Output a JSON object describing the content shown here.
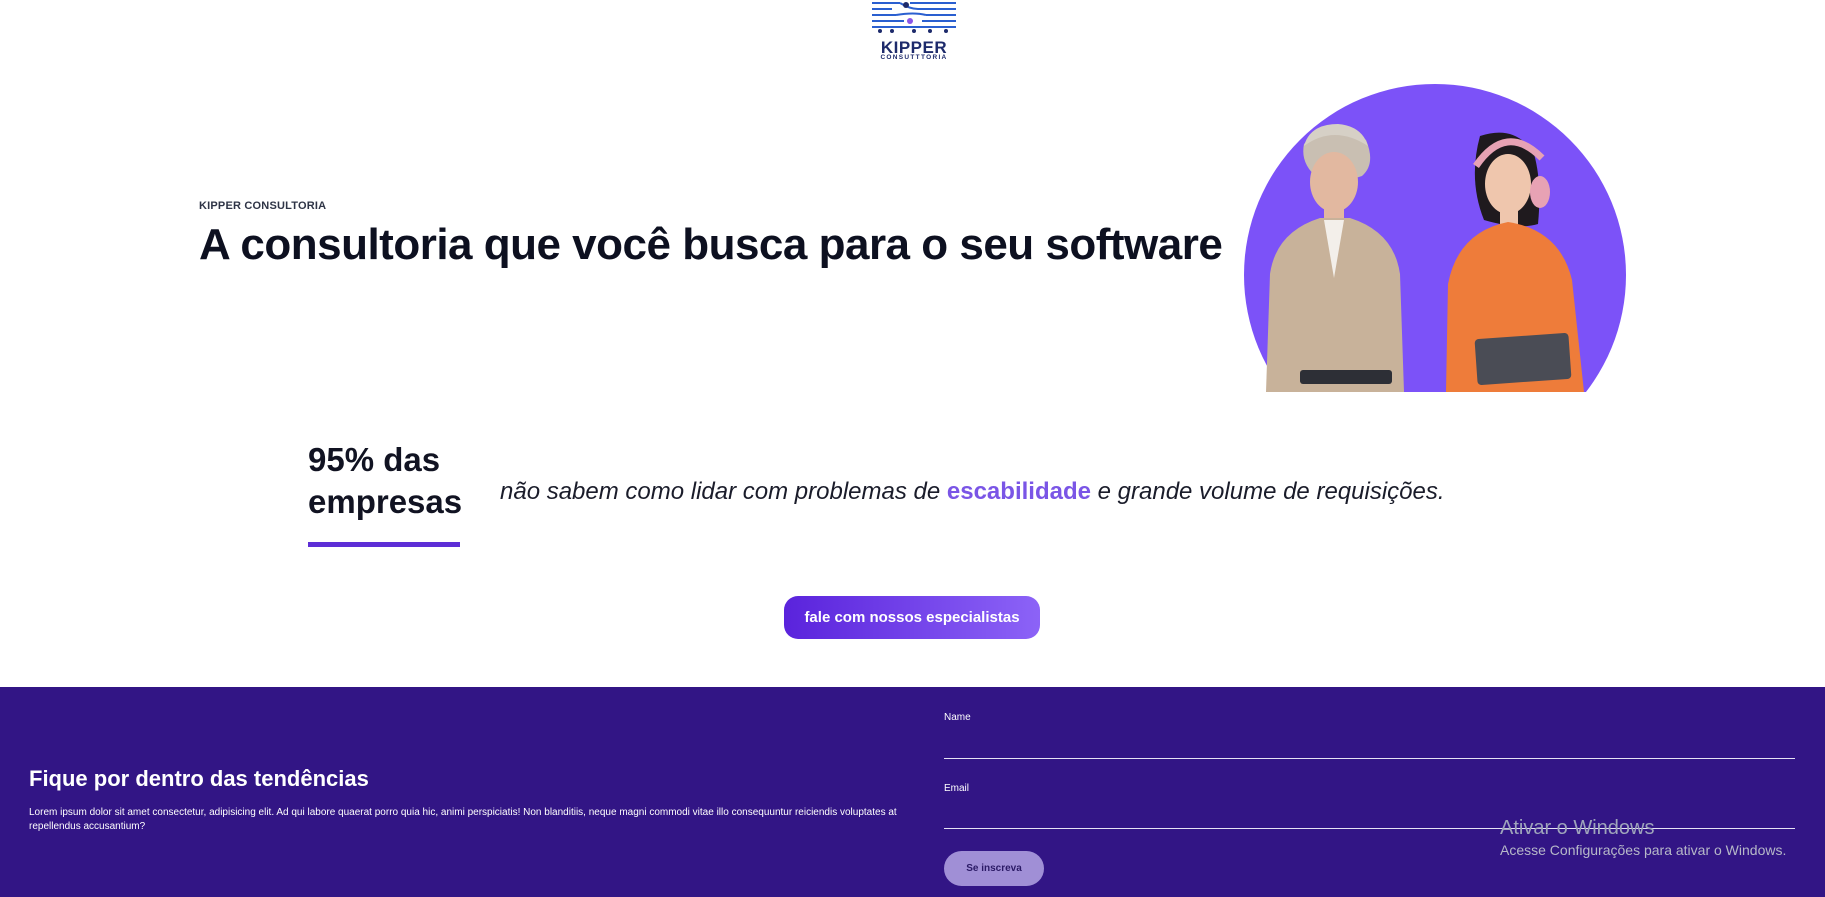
{
  "brand": {
    "name": "KIPPER",
    "subtitle": "CONSUTTTORIA",
    "logo_icon": "circuit-logo-icon",
    "color_primary": "#1d2a6b"
  },
  "hero": {
    "eyebrow": "KIPPER CONSULTORIA",
    "title": "A consultoria que você busca para o seu software",
    "image": "two-women-with-tablets",
    "accent_color": "#7c52f8"
  },
  "stat": {
    "number_line1": "95% das",
    "number_line2": "empresas",
    "text_before": "não sabem como lidar com problemas de ",
    "highlight": "escabilidade",
    "text_after": " e grande volume de requisições."
  },
  "cta": {
    "label": "fale com nossos especialistas"
  },
  "newsletter": {
    "background": "#321585",
    "title": "Fique por dentro das tendências",
    "description": "Lorem ipsum dolor sit amet consectetur, adipisicing elit. Ad qui labore quaerat porro quia hic, animi perspiciatis! Non blanditiis, neque magni commodi vitae illo consequuntur reiciendis voluptates at repellendus accusantium?",
    "name_label": "Name",
    "name_value": "",
    "email_label": "Email",
    "email_value": "",
    "submit_label": "Se inscreva"
  },
  "watermark": {
    "title": "Ativar o Windows",
    "subtitle": "Acesse Configurações para ativar o Windows."
  }
}
